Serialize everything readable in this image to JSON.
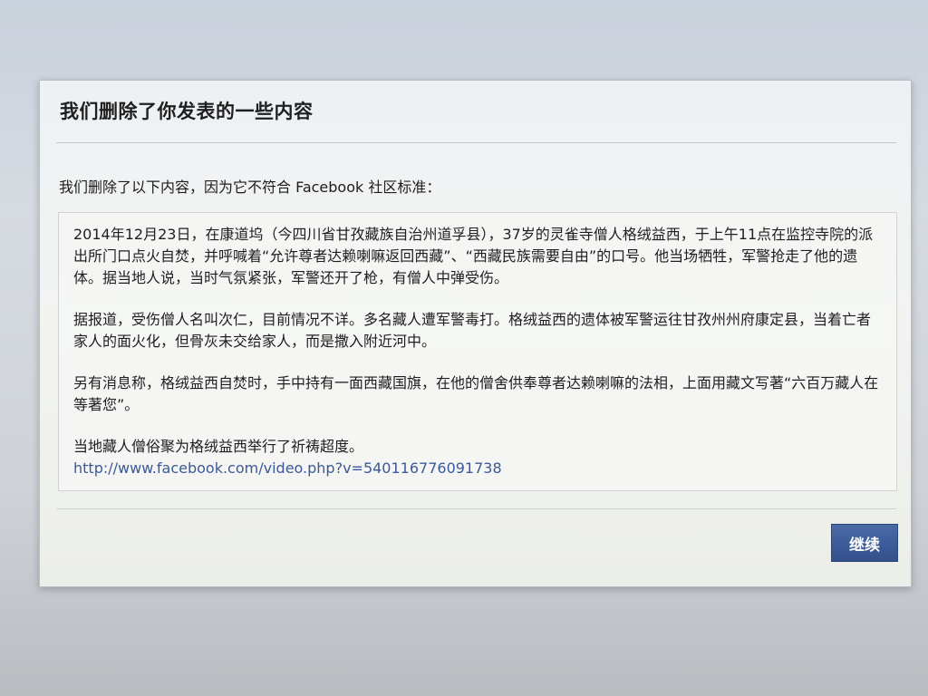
{
  "dialog": {
    "title": "我们删除了你发表的一些内容",
    "intro": "我们删除了以下内容，因为它不符合 Facebook 社区标准：",
    "content": {
      "paragraph1": "2014年12月23日，在康道坞（今四川省甘孜藏族自治州道孚县），37岁的灵雀寺僧人格绒益西，于上午11点在监控寺院的派出所门口点火自焚，并呼喊着“允许尊者达赖喇嘛返回西藏”、“西藏民族需要自由”的口号。他当场牺牲，军警抢走了他的遗体。据当地人说，当时气氛紧张，军警还开了枪，有僧人中弹受伤。",
      "paragraph2": "据报道，受伤僧人名叫次仁，目前情况不详。多名藏人遭军警毒打。格绒益西的遗体被军警运往甘孜州州府康定县，当着亡者家人的面火化，但骨灰未交给家人，而是撒入附近河中。",
      "paragraph3": "另有消息称，格绒益西自焚时，手中持有一面西藏国旗，在他的僧舍供奉尊者达赖喇嘛的法相，上面用藏文写著“六百万藏人在等著您”。",
      "paragraph4": "当地藏人僧俗聚为格绒益西举行了祈祷超度。",
      "link": "http://www.facebook.com/video.php?v=540116776091738"
    },
    "continue_label": "继续"
  },
  "colors": {
    "brand": "#3b5998",
    "button": "#3a5a98"
  }
}
